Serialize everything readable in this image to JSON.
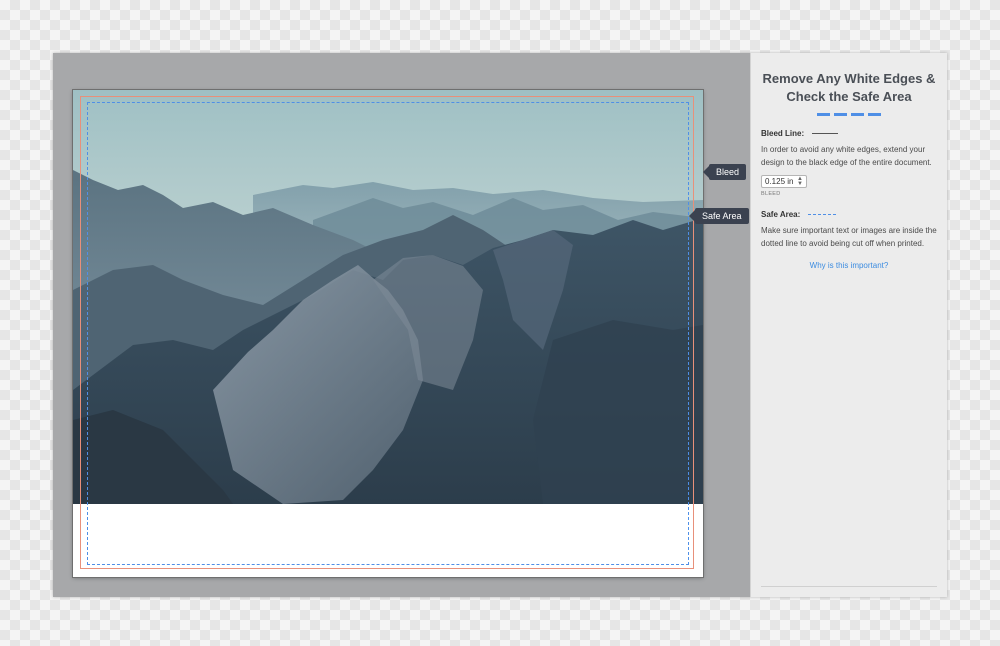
{
  "canvas": {
    "tags": {
      "bleed": "Bleed",
      "safe_area": "Safe Area"
    },
    "colors": {
      "bleed_line": "#e8907a",
      "safe_line": "#4f8fe6",
      "tag_bg": "#3b4250"
    }
  },
  "panel": {
    "title": "Remove Any White Edges & Check the Safe Area",
    "bleed_section": {
      "heading": "Bleed Line:",
      "description": "In order to avoid any white edges, extend your design to the black edge of the entire document.",
      "input_value": "0.125 in",
      "input_caption": "BLEED"
    },
    "safe_section": {
      "heading": "Safe Area:",
      "description": "Make sure important text or images are inside the dotted line to avoid being cut off when printed."
    },
    "link": "Why is this important?",
    "link_color": "#3c8ce0"
  }
}
